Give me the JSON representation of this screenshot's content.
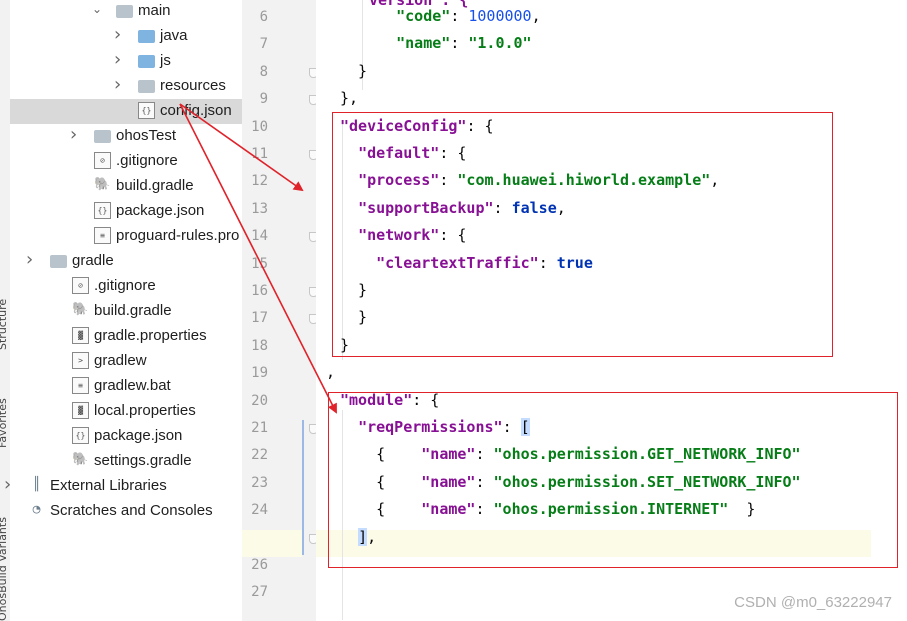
{
  "side_tabs": [
    "Structure",
    "Favorites",
    "OhosBuild Variants"
  ],
  "project_tree": [
    {
      "label": "main",
      "icon": "folder-icon",
      "chevron": "expanded",
      "indent": 3
    },
    {
      "label": "java",
      "icon": "folder-blue-icon",
      "chevron": "collapsed",
      "indent": 4
    },
    {
      "label": "js",
      "icon": "folder-blue-icon",
      "chevron": "collapsed",
      "indent": 4
    },
    {
      "label": "resources",
      "icon": "resources-folder-icon",
      "chevron": "collapsed",
      "indent": 4
    },
    {
      "label": "config.json",
      "icon": "json-file-icon",
      "chevron": "",
      "indent": 4,
      "selected": true
    },
    {
      "label": "ohosTest",
      "icon": "folder-icon",
      "chevron": "collapsed",
      "indent": 2
    },
    {
      "label": ".gitignore",
      "icon": "gitignore-file-icon",
      "chevron": "",
      "indent": 2
    },
    {
      "label": "build.gradle",
      "icon": "gradle-icon",
      "chevron": "",
      "indent": 2
    },
    {
      "label": "package.json",
      "icon": "json-file-icon",
      "chevron": "",
      "indent": 2
    },
    {
      "label": "proguard-rules.pro",
      "icon": "text-file-icon",
      "chevron": "",
      "indent": 2
    },
    {
      "label": "gradle",
      "icon": "folder-icon",
      "chevron": "collapsed",
      "indent": 0
    },
    {
      "label": ".gitignore",
      "icon": "gitignore-file-icon",
      "chevron": "",
      "indent": 1
    },
    {
      "label": "build.gradle",
      "icon": "gradle-icon",
      "chevron": "",
      "indent": 1
    },
    {
      "label": "gradle.properties",
      "icon": "properties-file-icon",
      "chevron": "",
      "indent": 1
    },
    {
      "label": "gradlew",
      "icon": "terminal-file-icon",
      "chevron": "",
      "indent": 1
    },
    {
      "label": "gradlew.bat",
      "icon": "text-file-icon",
      "chevron": "",
      "indent": 1
    },
    {
      "label": "local.properties",
      "icon": "properties-file-icon",
      "chevron": "",
      "indent": 1
    },
    {
      "label": "package.json",
      "icon": "json-file-icon",
      "chevron": "",
      "indent": 1
    },
    {
      "label": "settings.gradle",
      "icon": "gradle-icon",
      "chevron": "",
      "indent": 1
    },
    {
      "label": "External Libraries",
      "icon": "libraries-icon",
      "chevron": "collapsed",
      "indent": -1
    },
    {
      "label": "Scratches and Consoles",
      "icon": "scratches-icon",
      "chevron": "",
      "indent": -1
    }
  ],
  "line_numbers": [
    "6",
    "7",
    "8",
    "9",
    "10",
    "11",
    "12",
    "13",
    "14",
    "15",
    "16",
    "17",
    "18",
    "19",
    "20",
    "21",
    "22",
    "23",
    "24",
    "25",
    "26",
    "27"
  ],
  "current_line": "25",
  "code_lines": [
    [
      {
        "t": "p",
        "v": "    "
      },
      {
        "t": "s",
        "v": "\"code\""
      },
      {
        "t": "p",
        "v": ": "
      },
      {
        "t": "n",
        "v": "1000000"
      },
      {
        "t": "p",
        "v": ","
      }
    ],
    [
      {
        "t": "p",
        "v": "    "
      },
      {
        "t": "s",
        "v": "\"name\""
      },
      {
        "t": "p",
        "v": ": "
      },
      {
        "t": "s",
        "v": "\"1.0.0\""
      }
    ],
    [
      {
        "t": "p",
        "v": "  }"
      }
    ],
    [
      {
        "t": "p",
        "v": "},"
      }
    ],
    [
      {
        "t": "k",
        "v": "\"deviceConfig\""
      },
      {
        "t": "p",
        "v": ": {"
      }
    ],
    [
      {
        "t": "p",
        "v": "  "
      },
      {
        "t": "k",
        "v": "\"default\""
      },
      {
        "t": "p",
        "v": ": {"
      }
    ],
    [
      {
        "t": "p",
        "v": "  "
      },
      {
        "t": "k",
        "v": "\"process\""
      },
      {
        "t": "p",
        "v": ": "
      },
      {
        "t": "s",
        "v": "\"com.huawei.hiworld.example\""
      },
      {
        "t": "p",
        "v": ","
      }
    ],
    [
      {
        "t": "p",
        "v": "  "
      },
      {
        "t": "k",
        "v": "\"supportBackup\""
      },
      {
        "t": "p",
        "v": ": "
      },
      {
        "t": "kw",
        "v": "false"
      },
      {
        "t": "p",
        "v": ","
      }
    ],
    [
      {
        "t": "p",
        "v": "  "
      },
      {
        "t": "k",
        "v": "\"network\""
      },
      {
        "t": "p",
        "v": ": {"
      }
    ],
    [
      {
        "t": "p",
        "v": "    "
      },
      {
        "t": "k",
        "v": "\"cleartextTraffic\""
      },
      {
        "t": "p",
        "v": ": "
      },
      {
        "t": "kw",
        "v": "true"
      }
    ],
    [
      {
        "t": "p",
        "v": "  }"
      }
    ],
    [
      {
        "t": "p",
        "v": "  }"
      }
    ],
    [
      {
        "t": "p",
        "v": "}"
      }
    ],
    [
      {
        "t": "p",
        "v": ","
      }
    ],
    [
      {
        "t": "k",
        "v": "\"module\""
      },
      {
        "t": "p",
        "v": ": {"
      }
    ],
    [
      {
        "t": "p",
        "v": "  "
      },
      {
        "t": "k",
        "v": "\"reqPermissions\""
      },
      {
        "t": "p",
        "v": ": "
      },
      {
        "t": "hl",
        "v": "["
      }
    ],
    [
      {
        "t": "p",
        "v": "    {    "
      },
      {
        "t": "k",
        "v": "\"name\""
      },
      {
        "t": "p",
        "v": ": "
      },
      {
        "t": "s",
        "v": "\"ohos.permission.GET_NETWORK_INFO\""
      }
    ],
    [
      {
        "t": "p",
        "v": "    {    "
      },
      {
        "t": "k",
        "v": "\"name\""
      },
      {
        "t": "p",
        "v": ": "
      },
      {
        "t": "s",
        "v": "\"ohos.permission.SET_NETWORK_INFO\""
      }
    ],
    [
      {
        "t": "p",
        "v": "    {    "
      },
      {
        "t": "k",
        "v": "\"name\""
      },
      {
        "t": "p",
        "v": ": "
      },
      {
        "t": "s",
        "v": "\"ohos.permission.INTERNET\""
      },
      {
        "t": "p",
        "v": "  }"
      }
    ],
    [
      {
        "t": "p",
        "v": "  "
      },
      {
        "t": "hl",
        "v": "]"
      },
      {
        "t": "p",
        "v": ","
      }
    ],
    [],
    []
  ],
  "partial_top_line": "\"version\": {",
  "watermark": "CSDN @m0_63222947",
  "colors": {
    "annotation": "#e0222a",
    "key": "#871094",
    "string": "#067d17",
    "number": "#1750eb",
    "keyword": "#0033b3"
  }
}
